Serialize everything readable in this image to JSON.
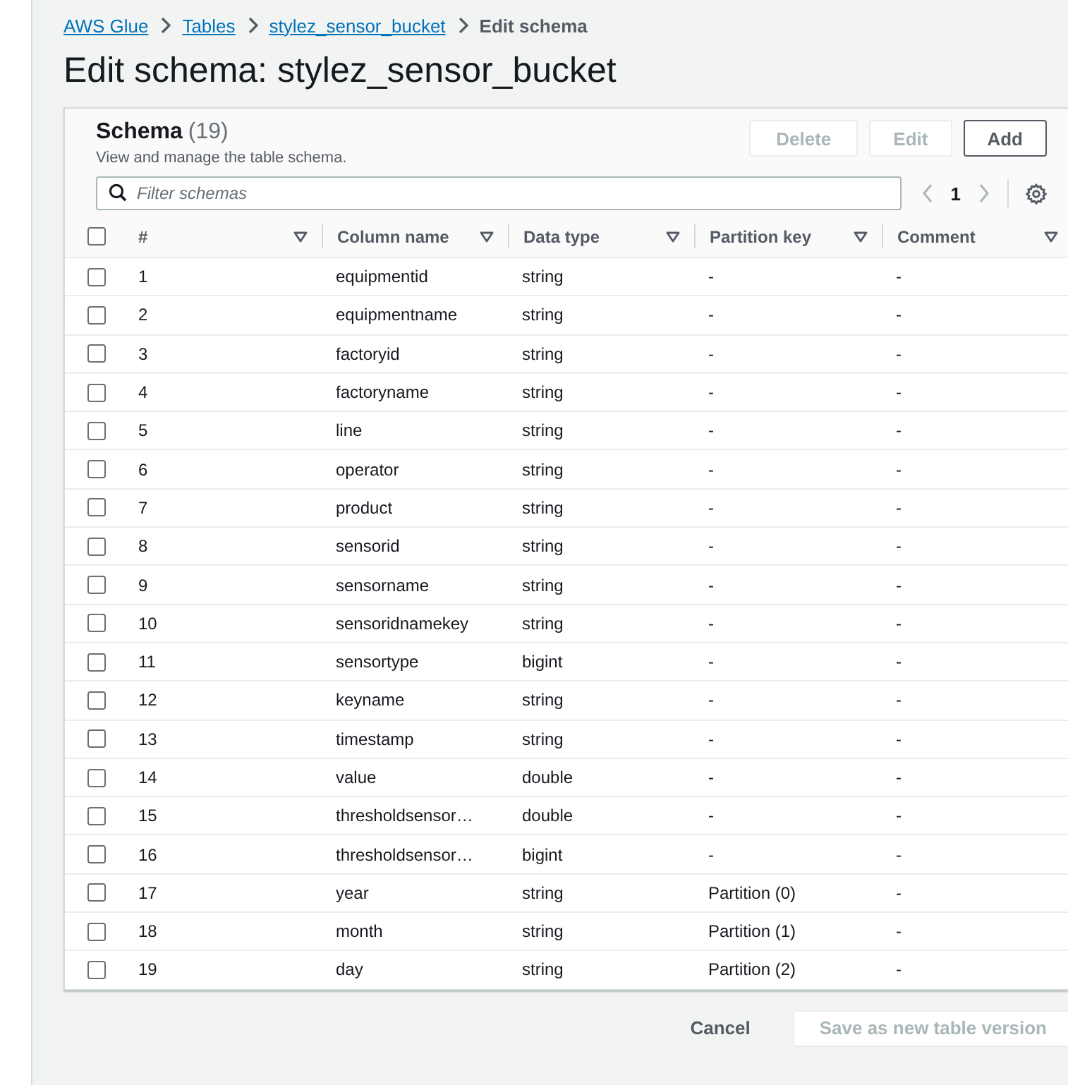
{
  "breadcrumbs": [
    {
      "label": "AWS Glue",
      "link": true
    },
    {
      "label": "Tables",
      "link": true
    },
    {
      "label": "stylez_sensor_bucket",
      "link": true
    },
    {
      "label": "Edit schema",
      "link": false
    }
  ],
  "title": "Edit schema: stylez_sensor_bucket",
  "schema": {
    "heading": "Schema",
    "count": "(19)",
    "description": "View and manage the table schema.",
    "buttons": [
      {
        "label": "Delete",
        "disabled": true
      },
      {
        "label": "Edit",
        "disabled": true
      },
      {
        "label": "Add",
        "disabled": false
      }
    ],
    "filter": {
      "placeholder": "Filter schemas"
    },
    "pagination": {
      "page": "1"
    },
    "select_all": {
      "checked": false
    },
    "columns": [
      "#",
      "Column name",
      "Data type",
      "Partition key",
      "Comment"
    ],
    "rows": [
      {
        "num": "1",
        "name": "equipmentid",
        "type": "string",
        "partition": "-",
        "comment": "-",
        "selected": false
      },
      {
        "num": "2",
        "name": "equipmentname",
        "type": "string",
        "partition": "-",
        "comment": "-",
        "selected": false
      },
      {
        "num": "3",
        "name": "factoryid",
        "type": "string",
        "partition": "-",
        "comment": "-",
        "selected": false
      },
      {
        "num": "4",
        "name": "factoryname",
        "type": "string",
        "partition": "-",
        "comment": "-",
        "selected": false
      },
      {
        "num": "5",
        "name": "line",
        "type": "string",
        "partition": "-",
        "comment": "-",
        "selected": false
      },
      {
        "num": "6",
        "name": "operator",
        "type": "string",
        "partition": "-",
        "comment": "-",
        "selected": false
      },
      {
        "num": "7",
        "name": "product",
        "type": "string",
        "partition": "-",
        "comment": "-",
        "selected": false
      },
      {
        "num": "8",
        "name": "sensorid",
        "type": "string",
        "partition": "-",
        "comment": "-",
        "selected": false
      },
      {
        "num": "9",
        "name": "sensorname",
        "type": "string",
        "partition": "-",
        "comment": "-",
        "selected": false
      },
      {
        "num": "10",
        "name": "sensoridnamekey",
        "type": "string",
        "partition": "-",
        "comment": "-",
        "selected": false
      },
      {
        "num": "11",
        "name": "sensortype",
        "type": "bigint",
        "partition": "-",
        "comment": "-",
        "selected": false
      },
      {
        "num": "12",
        "name": "keyname",
        "type": "string",
        "partition": "-",
        "comment": "-",
        "selected": false
      },
      {
        "num": "13",
        "name": "timestamp",
        "type": "string",
        "partition": "-",
        "comment": "-",
        "selected": false
      },
      {
        "num": "14",
        "name": "value",
        "type": "double",
        "partition": "-",
        "comment": "-",
        "selected": false
      },
      {
        "num": "15",
        "name": "thresholdsensor…",
        "type": "double",
        "partition": "-",
        "comment": "-",
        "selected": false
      },
      {
        "num": "16",
        "name": "thresholdsensor…",
        "type": "bigint",
        "partition": "-",
        "comment": "-",
        "selected": false
      },
      {
        "num": "17",
        "name": "year",
        "type": "string",
        "partition": "Partition (0)",
        "comment": "-",
        "selected": false
      },
      {
        "num": "18",
        "name": "month",
        "type": "string",
        "partition": "Partition (1)",
        "comment": "-",
        "selected": false
      },
      {
        "num": "19",
        "name": "day",
        "type": "string",
        "partition": "Partition (2)",
        "comment": "-",
        "selected": false
      }
    ]
  },
  "footer": {
    "cancel": "Cancel",
    "save": {
      "label": "Save as new table version",
      "disabled": true
    }
  }
}
